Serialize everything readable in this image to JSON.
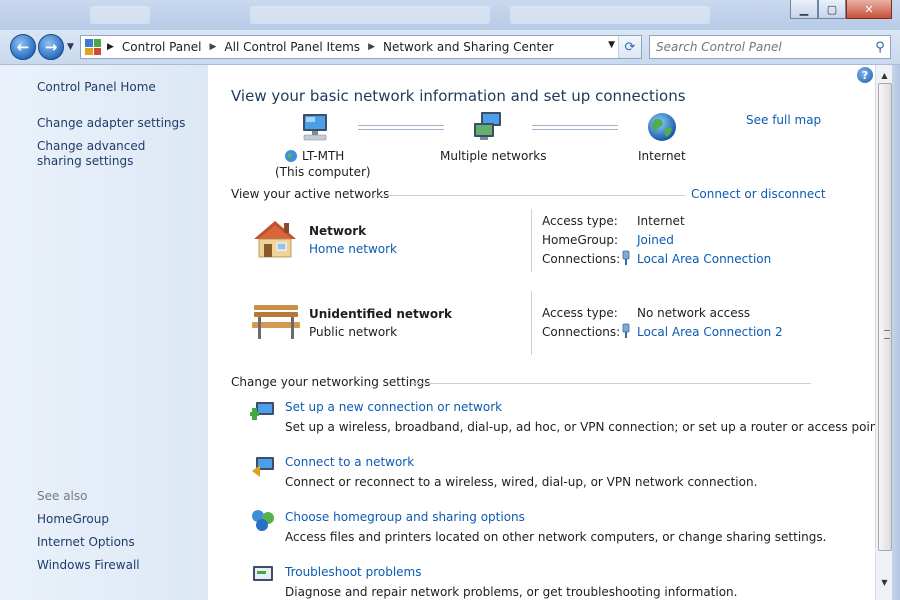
{
  "window": {
    "minimize_glyph": "▁",
    "maximize_glyph": "▢",
    "close_glyph": "✕"
  },
  "address": {
    "back_glyph": "←",
    "forward_glyph": "→",
    "crumbs": [
      "Control Panel",
      "All Control Panel Items",
      "Network and Sharing Center"
    ],
    "refresh_glyph": "⟳",
    "search_placeholder": "Search Control Panel",
    "search_glyph": "⚲"
  },
  "sidebar": {
    "home": "Control Panel Home",
    "items": [
      "Change adapter settings",
      "Change advanced sharing settings"
    ],
    "see_also_label": "See also",
    "see_also": [
      "HomeGroup",
      "Internet Options",
      "Windows Firewall"
    ]
  },
  "main": {
    "heading": "View your basic network information and set up connections",
    "see_full_map": "See full map",
    "map": {
      "computer_name": "LT-MTH",
      "computer_sub": "(This computer)",
      "middle": "Multiple networks",
      "internet": "Internet"
    },
    "active_label": "View your active networks",
    "connect_disconnect": "Connect or disconnect",
    "networks": [
      {
        "name": "Network",
        "type": "Home network",
        "rows": [
          {
            "label": "Access type:",
            "value": "Internet"
          },
          {
            "label": "HomeGroup:",
            "value": "Joined"
          },
          {
            "label": "Connections:",
            "value": "Local Area Connection"
          }
        ]
      },
      {
        "name": "Unidentified network",
        "type": "Public network",
        "rows": [
          {
            "label": "Access type:",
            "value": "No network access"
          },
          {
            "label": "Connections:",
            "value": "Local Area Connection 2"
          }
        ]
      }
    ],
    "settings_label": "Change your networking settings",
    "tasks": [
      {
        "title": "Set up a new connection or network",
        "desc": "Set up a wireless, broadband, dial-up, ad hoc, or VPN connection; or set up a router or access point."
      },
      {
        "title": "Connect to a network",
        "desc": "Connect or reconnect to a wireless, wired, dial-up, or VPN network connection."
      },
      {
        "title": "Choose homegroup and sharing options",
        "desc": "Access files and printers located on other network computers, or change sharing settings."
      },
      {
        "title": "Troubleshoot problems",
        "desc": "Diagnose and repair network problems, or get troubleshooting information."
      }
    ],
    "help_glyph": "?"
  }
}
